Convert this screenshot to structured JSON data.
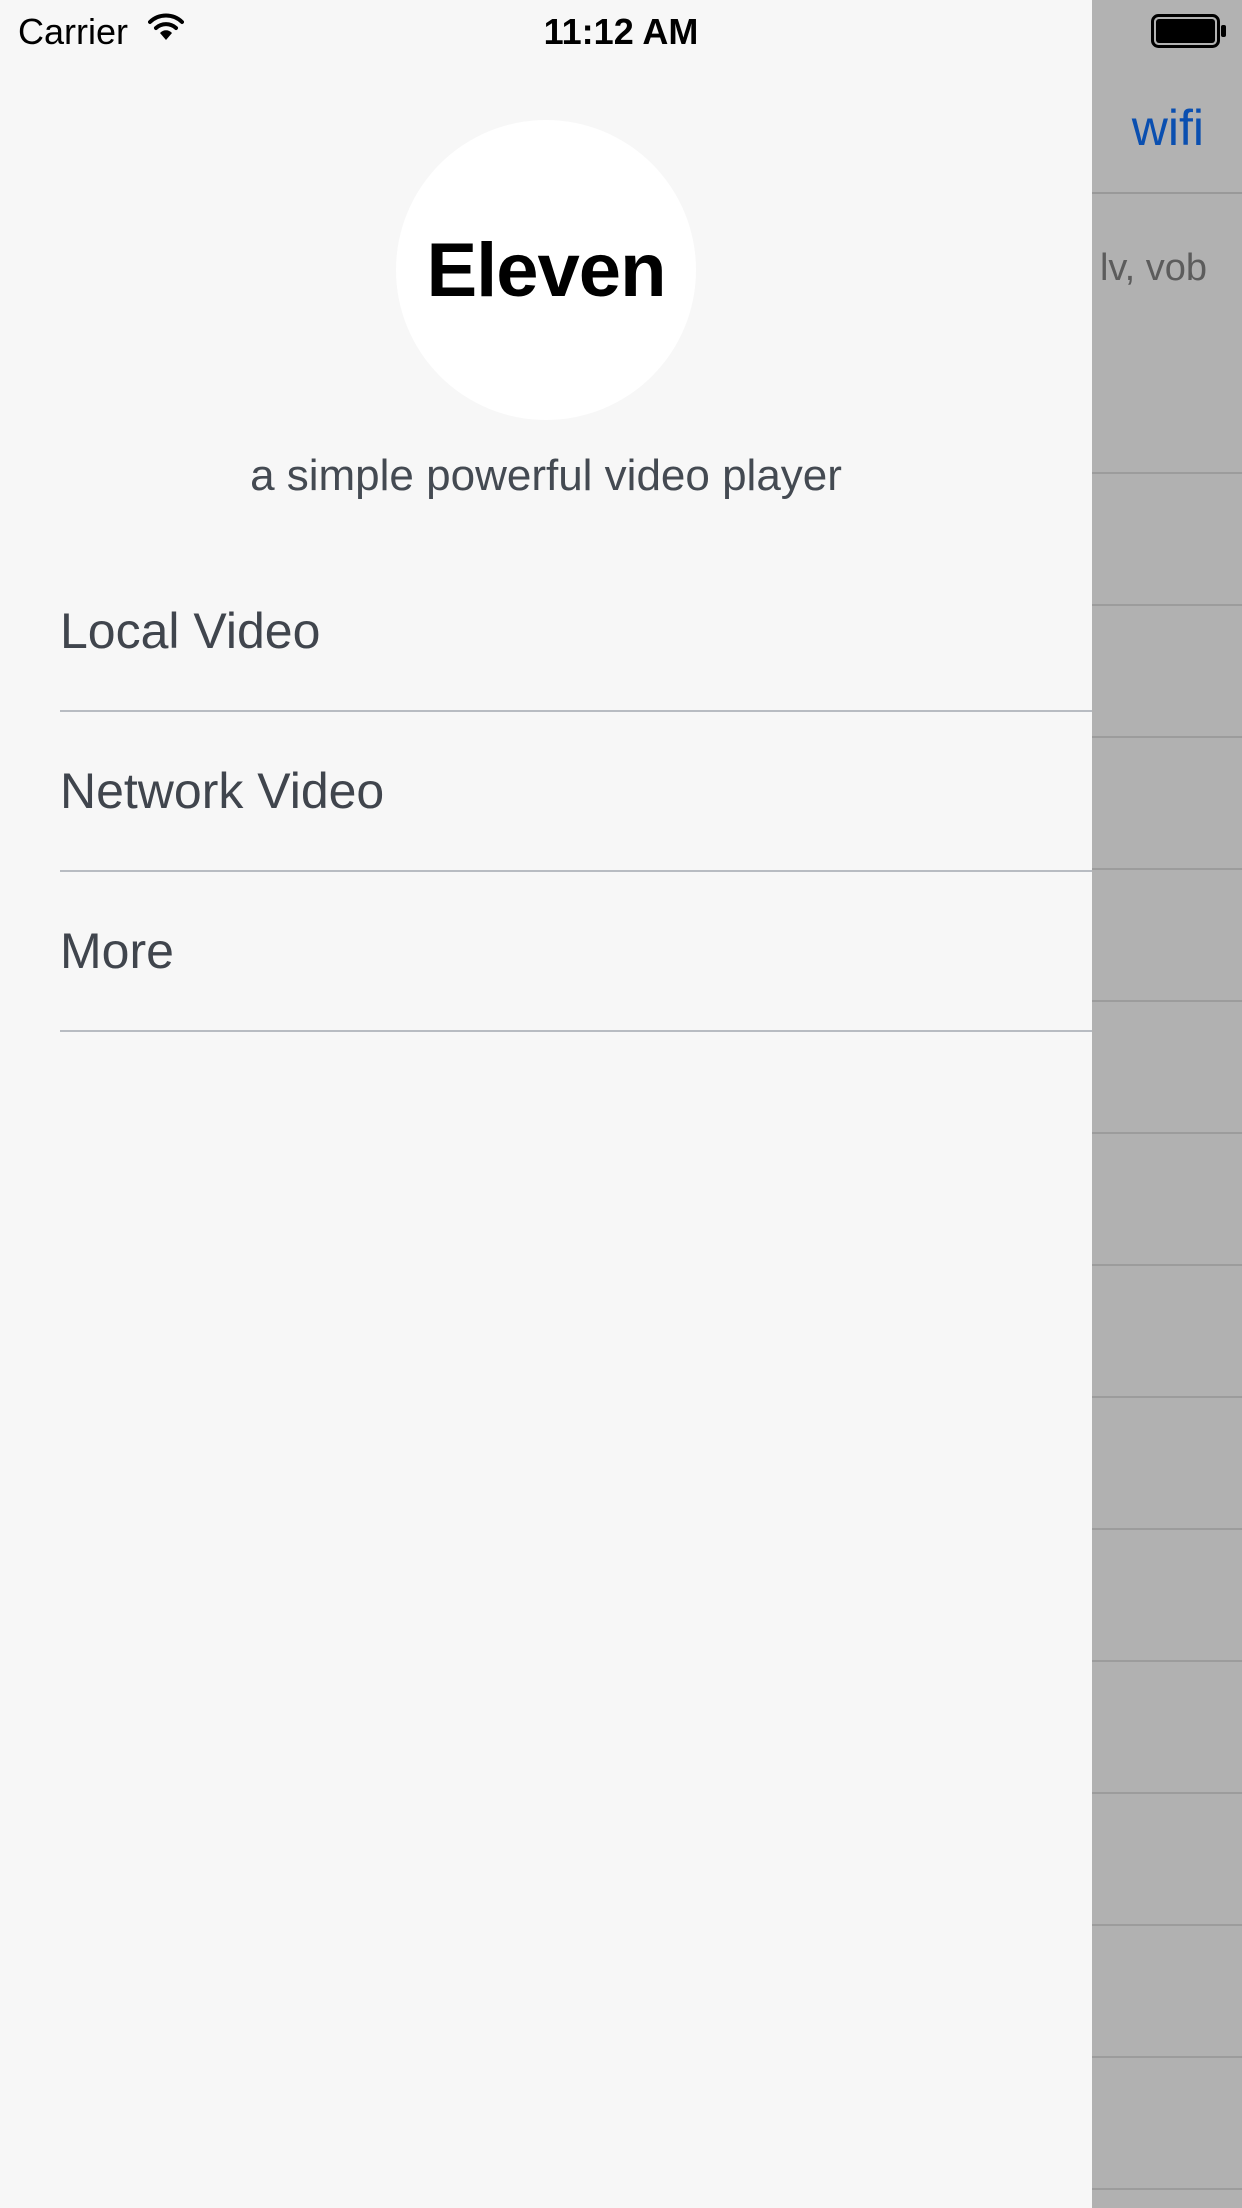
{
  "status_bar": {
    "carrier": "Carrier",
    "time": "11:12 AM"
  },
  "background_screen": {
    "wifi_button": "wifi",
    "formats_text": "lv, vob"
  },
  "drawer": {
    "logo_text": "Eleven",
    "tagline": "a simple powerful video player",
    "menu_items": [
      {
        "label": "Local Video"
      },
      {
        "label": "Network Video"
      },
      {
        "label": "More"
      }
    ]
  },
  "colors": {
    "drawer_background": "#f7f7f7",
    "overlay_gray": "#b1b1b1",
    "wifi_link_blue": "#0a4fb0",
    "menu_text": "#40454d"
  },
  "icons": [
    "wifi-signal-icon",
    "battery-icon"
  ]
}
